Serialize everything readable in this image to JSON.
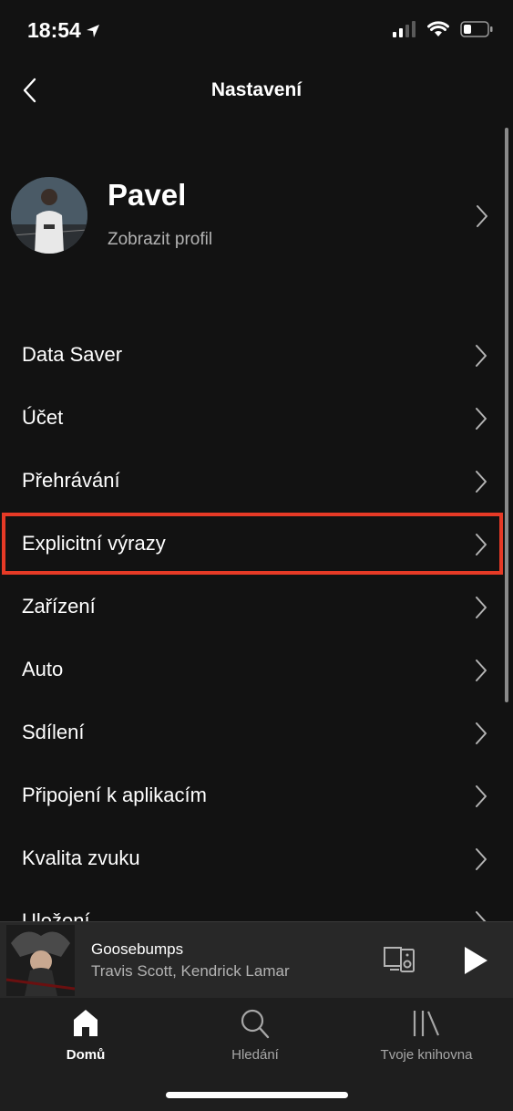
{
  "status_bar": {
    "time": "18:54"
  },
  "header": {
    "title": "Nastavení"
  },
  "profile": {
    "name": "Pavel",
    "subtitle": "Zobrazit profil"
  },
  "menu": {
    "items": [
      {
        "label": "Data Saver"
      },
      {
        "label": "Účet"
      },
      {
        "label": "Přehrávání"
      },
      {
        "label": "Explicitní výrazy",
        "highlighted": true
      },
      {
        "label": "Zařízení"
      },
      {
        "label": "Auto"
      },
      {
        "label": "Sdílení"
      },
      {
        "label": "Připojení k aplikacím"
      },
      {
        "label": "Kvalita zvuku"
      },
      {
        "label": "Uložení"
      }
    ]
  },
  "now_playing": {
    "title": "Goosebumps",
    "artist": "Travis Scott, Kendrick Lamar"
  },
  "tabs": [
    {
      "label": "Domů",
      "icon": "home-icon",
      "active": true
    },
    {
      "label": "Hledání",
      "icon": "search-icon",
      "active": false
    },
    {
      "label": "Tvoje knihovna",
      "icon": "library-icon",
      "active": false
    }
  ],
  "colors": {
    "background": "#121212",
    "highlight_border": "#e63a26",
    "player_bg": "#282828",
    "secondary_text": "#b3b3b3"
  }
}
